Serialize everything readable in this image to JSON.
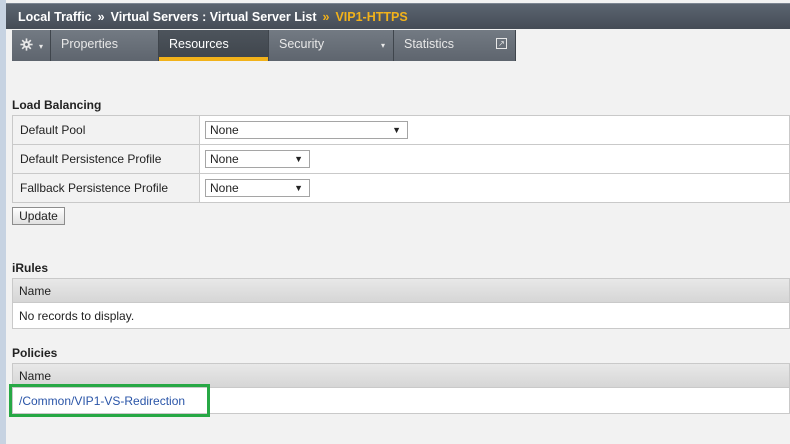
{
  "breadcrumb": {
    "part1": "Local Traffic",
    "sep1": "»",
    "part2": "Virtual Servers : Virtual Server List",
    "sep2": "»",
    "current": "VIP1-HTTPS"
  },
  "tabs": {
    "gear_icon": "gear-icon",
    "gear_caret": "▾",
    "properties": "Properties",
    "resources": "Resources",
    "security": "Security",
    "security_caret": "▾",
    "statistics": "Statistics",
    "statistics_icon": "↗"
  },
  "load_balancing": {
    "title": "Load Balancing",
    "rows": [
      {
        "label": "Default Pool",
        "value": "None",
        "arrow": "▼"
      },
      {
        "label": "Default Persistence Profile",
        "value": "None",
        "arrow": "▼"
      },
      {
        "label": "Fallback Persistence Profile",
        "value": "None",
        "arrow": "▼"
      }
    ],
    "update_label": "Update"
  },
  "irules": {
    "title": "iRules",
    "column": "Name",
    "empty_text": "No records to display."
  },
  "policies": {
    "title": "Policies",
    "column": "Name",
    "items": [
      "/Common/VIP1-VS-Redirection"
    ]
  },
  "colors": {
    "accent": "#f2b21a",
    "highlight": "#27a845",
    "link": "#2a55a8"
  }
}
